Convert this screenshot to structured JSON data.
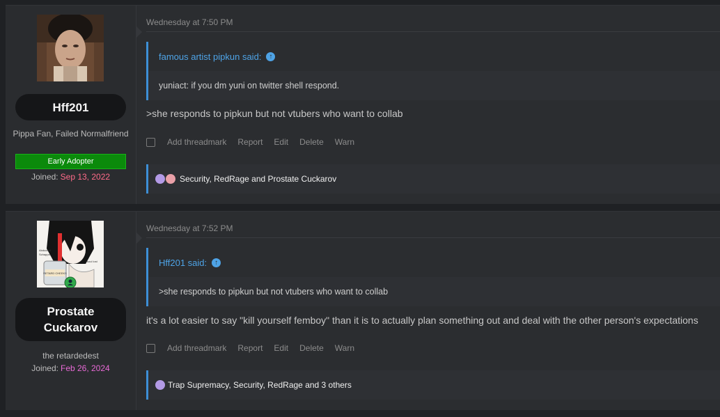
{
  "posts": [
    {
      "user": {
        "name": "Hff201",
        "title": "Pippa Fan, Failed Normalfriend",
        "badge": "Early Adopter",
        "joined_label": "Joined:",
        "joined_date": "Sep 13, 2022",
        "joined_color": "#ff6b8a"
      },
      "timestamp": "Wednesday at 7:50 PM",
      "quote": {
        "author": "famous artist pipkun said:",
        "text": "yuniact: if you dm yuni on twitter shell respond."
      },
      "message": ">she responds to pipkun but not vtubers who want to collab",
      "actions": [
        "Add threadmark",
        "Report",
        "Edit",
        "Delete",
        "Warn"
      ],
      "reactions": "Security, RedRage and Prostate Cuckarov"
    },
    {
      "user": {
        "name_line1": "Prostate",
        "name_line2": "Cuckarov",
        "title": "the retardedest",
        "joined_label": "Joined:",
        "joined_date": "Feb 26, 2024",
        "joined_color": "#e86ad6"
      },
      "timestamp": "Wednesday at 7:52 PM",
      "quote": {
        "author": "Hff201 said:",
        "text": ">she responds to pipkun but not vtubers who want to collab"
      },
      "message": "it's a lot easier to say \"kill yourself femboy\" than it is to actually plan something out and deal with the other person's expectations",
      "actions": [
        "Add threadmark",
        "Report",
        "Edit",
        "Delete",
        "Warn"
      ],
      "reactions": "Trap Supremacy, Security, RedRage and 3 others"
    }
  ],
  "avatar_text": {
    "jar_label": "RETARD CHEEKS",
    "side_label_1": "Abducted",
    "side_label_2": "Schapps",
    "soul_label": "soul lost"
  },
  "colors": {
    "accent": "#3d8fd6",
    "link": "#4ea3e6",
    "badge_green": "#0b8a0b"
  }
}
